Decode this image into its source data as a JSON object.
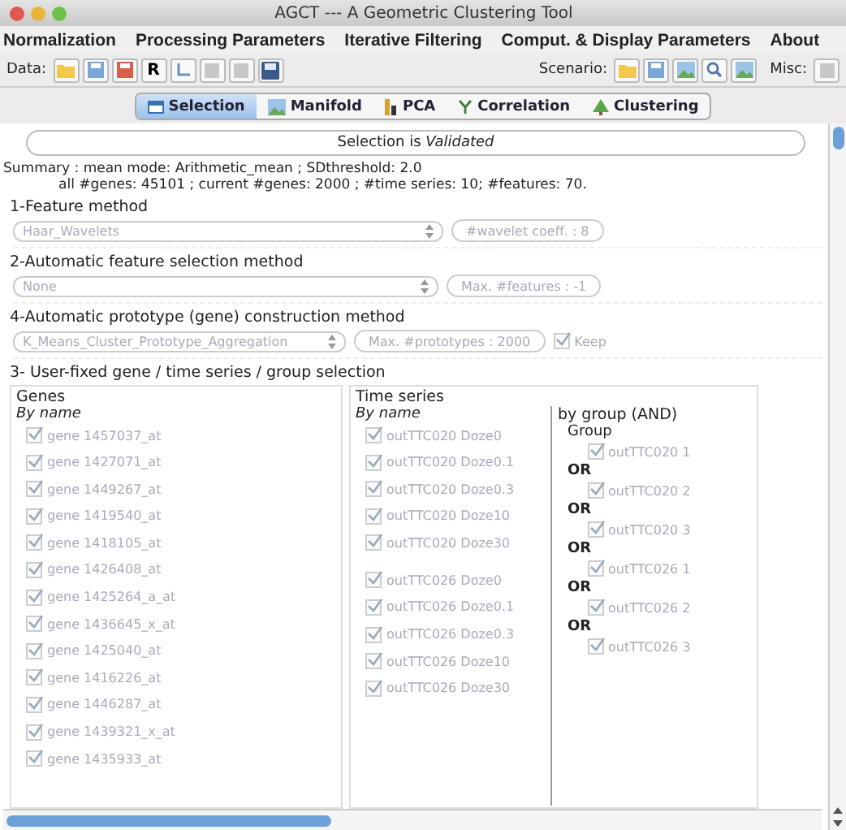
{
  "window": {
    "title": "AGCT --- A Geometric Clustering Tool"
  },
  "menu": [
    "Normalization",
    "Processing Parameters",
    "Iterative Filtering",
    "Comput. & Display Parameters",
    "About"
  ],
  "toolbar": {
    "groups": [
      {
        "label": "Data:",
        "tools": [
          {
            "kind": "folder"
          },
          {
            "kind": "disk"
          },
          {
            "kind": "disk-red"
          },
          {
            "kind": "letter",
            "text": "R"
          },
          {
            "kind": "connector"
          },
          {
            "kind": "blank"
          },
          {
            "kind": "blank"
          },
          {
            "kind": "floppy"
          }
        ]
      },
      {
        "label": "Scenario:",
        "tools": [
          {
            "kind": "folder"
          },
          {
            "kind": "disk"
          },
          {
            "kind": "image"
          },
          {
            "kind": "magnifier"
          },
          {
            "kind": "image"
          }
        ]
      },
      {
        "label": "Misc:",
        "tools": [
          {
            "kind": "blank"
          }
        ]
      }
    ]
  },
  "tabs": [
    {
      "label": "Selection",
      "kind": "window",
      "selected": true
    },
    {
      "label": "Manifold",
      "kind": "image",
      "selected": false
    },
    {
      "label": "PCA",
      "kind": "bars",
      "selected": false
    },
    {
      "label": "Correlation",
      "kind": "network",
      "selected": false
    },
    {
      "label": "Clustering",
      "kind": "tree",
      "selected": false
    }
  ],
  "status": "Selection is *Validated*",
  "summary": [
    "Summary : mean mode: Arithmetic_mean ; SDthreshold: 2.0",
    "all #genes: 45101 ; current #genes: 2000 ; #time series: 10; #features: 70."
  ],
  "sections": [
    {
      "title": "1-Feature method",
      "combo": "Haar_Wavelets",
      "button": "#wavelet coeff. : 8"
    },
    {
      "title": "2-Automatic feature selection method",
      "combo": "None",
      "button": "Max. #features : -1"
    },
    {
      "title": "4-Automatic prototype (gene) construction method",
      "combo": "K_Means_Cluster_Prototype_Aggregation",
      "button": "Max. #prototypes : 2000",
      "keep": {
        "label": "Keep",
        "checked": true
      }
    }
  ],
  "selection": {
    "title": "3- User-fixed gene / time series / group selection",
    "genes": {
      "title": "Genes",
      "subtitle": "By name",
      "items": [
        {
          "label": "gene 1457037_at",
          "checked": true
        },
        {
          "label": "gene 1427071_at",
          "checked": true
        },
        {
          "label": "gene 1449267_at",
          "checked": true
        },
        {
          "label": "gene 1419540_at",
          "checked": true
        },
        {
          "label": "gene 1418105_at",
          "checked": true
        },
        {
          "label": "gene 1426408_at",
          "checked": true
        },
        {
          "label": "gene 1425264_a_at",
          "checked": true
        },
        {
          "label": "gene 1436645_x_at",
          "checked": true
        },
        {
          "label": "gene 1425040_at",
          "checked": true
        },
        {
          "label": "gene 1416226_at",
          "checked": true
        },
        {
          "label": "gene 1446287_at",
          "checked": true
        },
        {
          "label": "gene 1439321_x_at",
          "checked": true
        },
        {
          "label": "gene 1435933_at",
          "checked": true
        }
      ]
    },
    "time_series": {
      "title": "Time series",
      "subtitle": "By name",
      "blocks": [
        [
          {
            "label": "outTTC020 Doze0",
            "checked": true
          },
          {
            "label": "outTTC020 Doze0.1",
            "checked": true
          },
          {
            "label": "outTTC020 Doze0.3",
            "checked": true
          },
          {
            "label": "outTTC020 Doze10",
            "checked": true
          },
          {
            "label": "outTTC020 Doze30",
            "checked": true
          }
        ],
        [
          {
            "label": "outTTC026 Doze0",
            "checked": true
          },
          {
            "label": "outTTC026 Doze0.1",
            "checked": true
          },
          {
            "label": "outTTC026 Doze0.3",
            "checked": true
          },
          {
            "label": "outTTC026 Doze10",
            "checked": true
          },
          {
            "label": "outTTC026 Doze30",
            "checked": true
          }
        ]
      ]
    },
    "groups": {
      "title": "by group (AND)",
      "header": "Group",
      "items": [
        {
          "kind": "option",
          "label": "outTTC020 1",
          "checked": true
        },
        {
          "kind": "or",
          "label": "OR"
        },
        {
          "kind": "option",
          "label": "outTTC020 2",
          "checked": true
        },
        {
          "kind": "or",
          "label": "OR"
        },
        {
          "kind": "option",
          "label": "outTTC020 3",
          "checked": true
        },
        {
          "kind": "or",
          "label": "OR"
        },
        {
          "kind": "option",
          "label": "outTTC026 1",
          "checked": true
        },
        {
          "kind": "or",
          "label": "OR"
        },
        {
          "kind": "option",
          "label": "outTTC026 2",
          "checked": true
        },
        {
          "kind": "or",
          "label": "OR"
        },
        {
          "kind": "option",
          "label": "outTTC026 3",
          "checked": true
        }
      ]
    }
  }
}
